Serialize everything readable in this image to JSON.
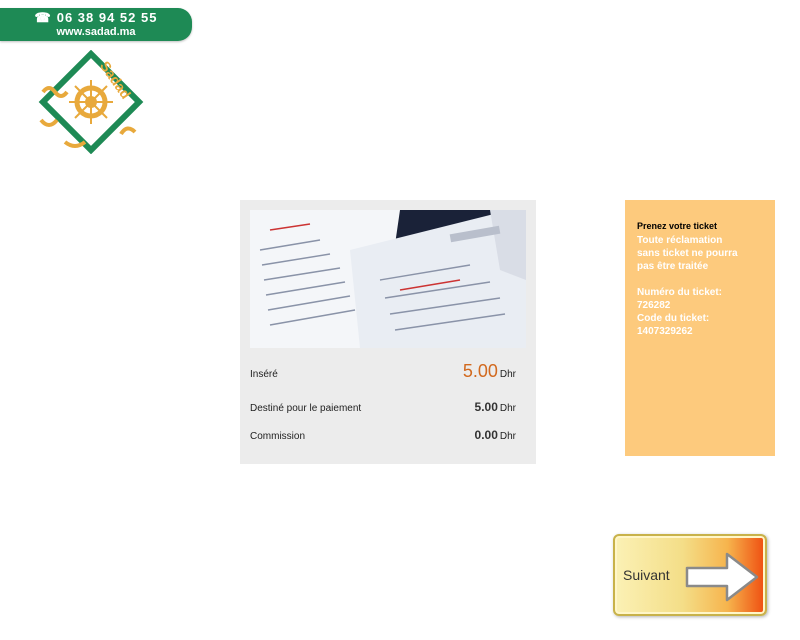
{
  "banner": {
    "phone_icon": "☎",
    "phone": "06 38 94 52 55",
    "website": "www.sadad.ma"
  },
  "logo": {
    "icon": "sadad-logo",
    "text_latin": "Sadad",
    "colors": {
      "green": "#1e8a55",
      "gold": "#e8a93c"
    }
  },
  "payment": {
    "image": "receipts-photo",
    "inserted_label": "Inséré",
    "inserted_amount": "5.00",
    "destined_label": "Destiné pour le paiement",
    "destined_amount": "5.00",
    "commission_label": "Commission",
    "commission_amount": "0.00",
    "currency": "Dhr",
    "accent_color": "#d2691e"
  },
  "info_panel": {
    "take_ticket": "Prenez votre ticket",
    "warning_lines": [
      "Toute réclamation",
      "sans ticket ne pourra",
      "pas être traitée"
    ],
    "ticket_number_label": "Numéro du ticket:",
    "ticket_number": "726282",
    "ticket_code_label": "Code du ticket:",
    "ticket_code": "1407329262",
    "background_color": "#fdca7d"
  },
  "next_button": {
    "label": "Suivant",
    "icon": "arrow-right-icon"
  }
}
